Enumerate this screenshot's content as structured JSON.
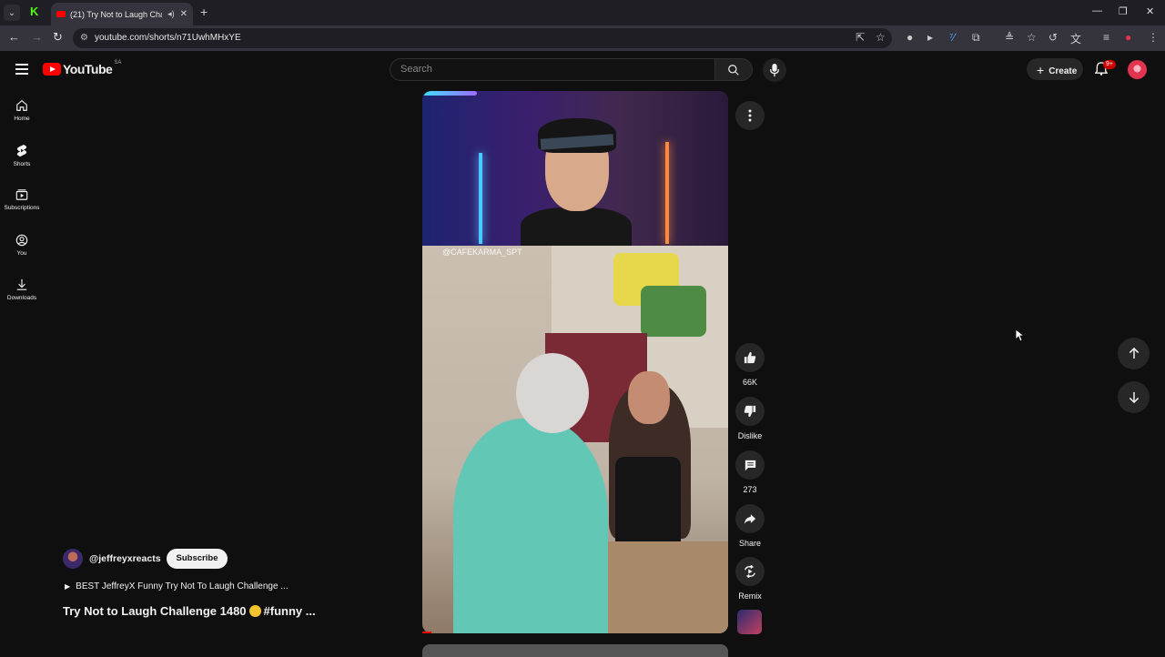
{
  "browser": {
    "tab_title": "(21) Try Not to Laugh Challe",
    "url": "youtube.com/shorts/n71UwhMHxYE"
  },
  "header": {
    "logo_text": "YouTube",
    "country_code": "SA",
    "search_placeholder": "Search",
    "create_label": "Create",
    "notifications_badge": "9+"
  },
  "sidebar": {
    "items": [
      {
        "label": "Home",
        "icon": "home-icon"
      },
      {
        "label": "Shorts",
        "icon": "shorts-icon"
      },
      {
        "label": "Subscriptions",
        "icon": "subscriptions-icon"
      },
      {
        "label": "You",
        "icon": "user-icon"
      },
      {
        "label": "Downloads",
        "icon": "download-icon"
      }
    ]
  },
  "video": {
    "watermark": "@CAFEKARMA_SPT"
  },
  "actions": {
    "like_count": "66K",
    "dislike_label": "Dislike",
    "comment_count": "273",
    "share_label": "Share",
    "remix_label": "Remix"
  },
  "channel": {
    "handle": "@jeffreyxreacts",
    "subscribe_label": "Subscribe",
    "playlist": "BEST JeffreyX Funny Try Not To Laugh Challenge ...",
    "title_prefix": "Try Not to Laugh Challenge 1480",
    "title_suffix": "#funny ..."
  }
}
